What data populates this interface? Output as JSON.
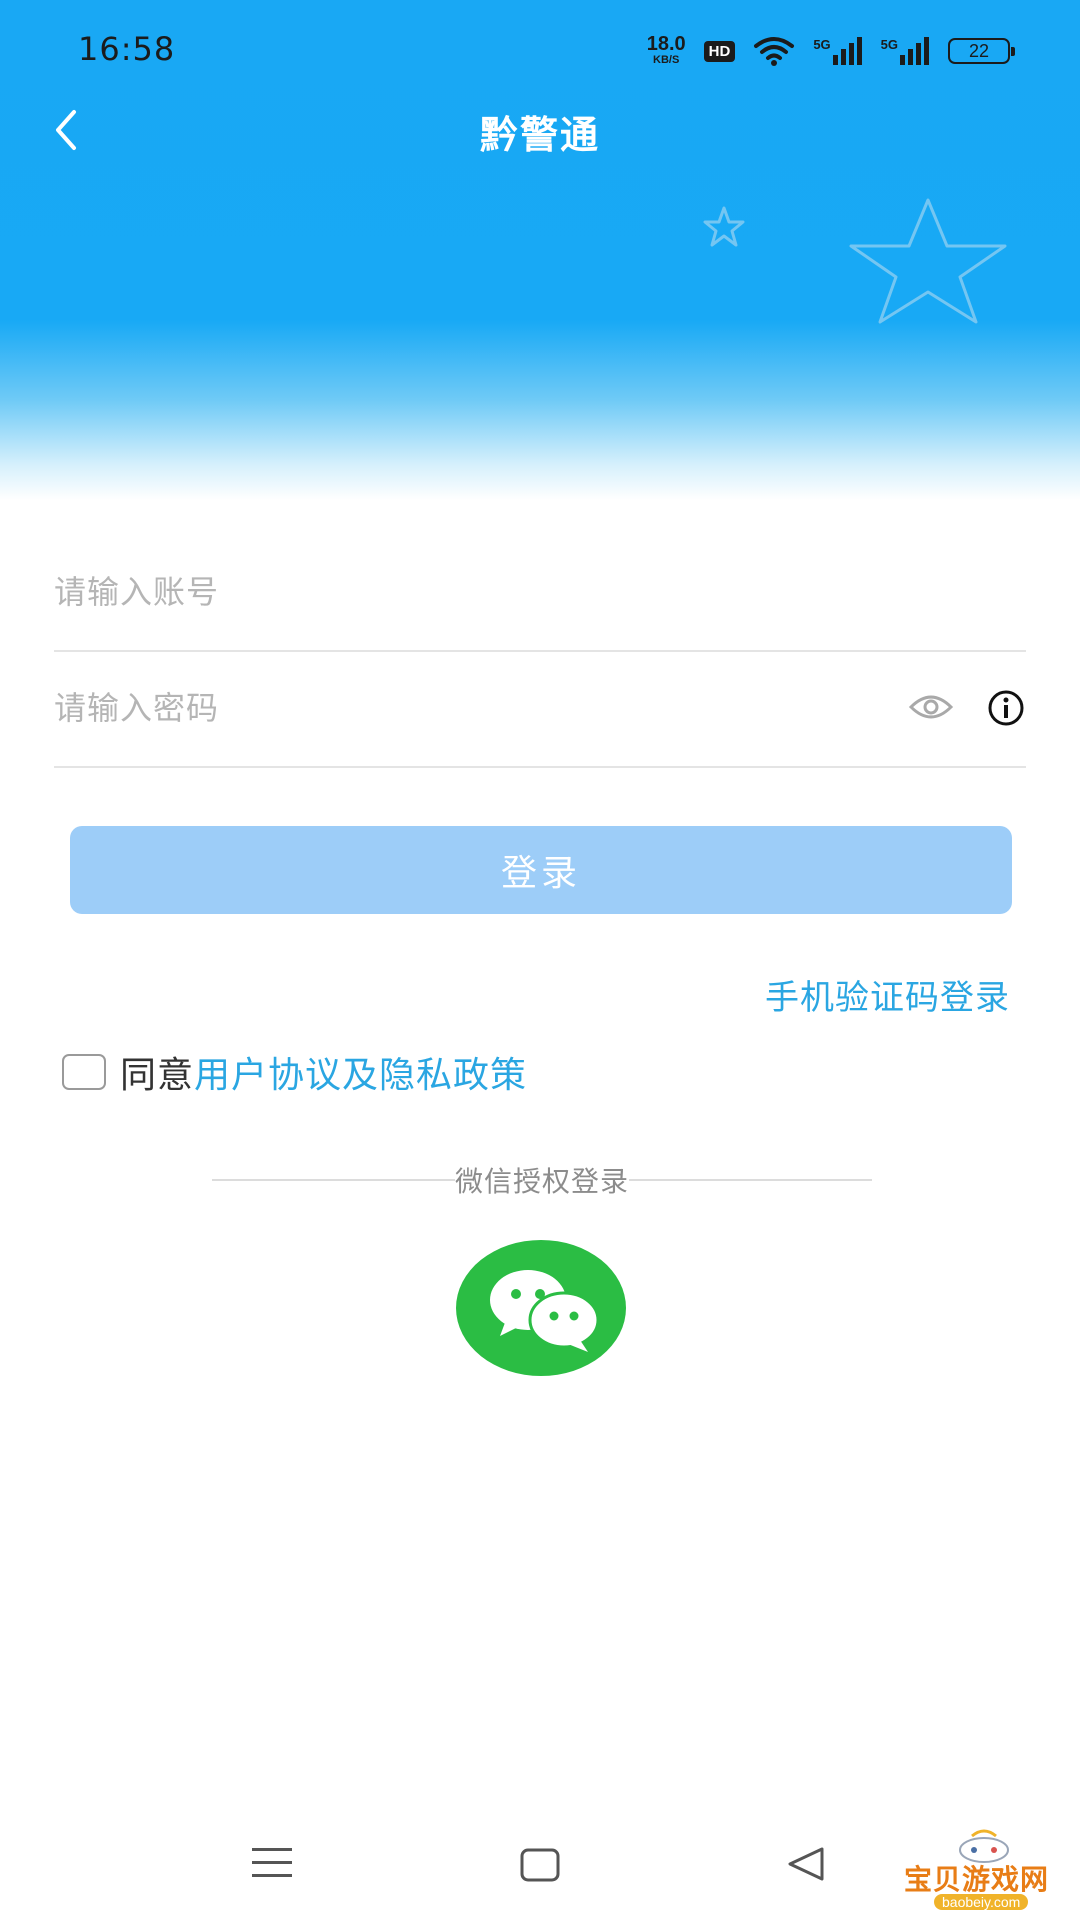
{
  "status_bar": {
    "time": "16:58",
    "net_speed_value": "18.0",
    "net_speed_unit": "KB/S",
    "hd_badge": "HD",
    "signal_1": "5G",
    "signal_2": "5G",
    "battery": "22"
  },
  "header": {
    "title": "黔警通"
  },
  "form": {
    "account_placeholder": "请输入账号",
    "password_placeholder": "请输入密码",
    "login_label": "登录",
    "sms_login_label": "手机验证码登录"
  },
  "agreement": {
    "prefix": "同意",
    "link_text": "用户协议及隐私政策"
  },
  "wechat": {
    "divider_label": "微信授权登录"
  },
  "watermark": {
    "text": "宝贝游戏网",
    "url": "baobeiy.com"
  },
  "colors": {
    "header_blue": "#19a8f4",
    "link_blue": "#2aa6e2",
    "login_button": "#9dcdf8",
    "wechat_green": "#2bbd44"
  }
}
